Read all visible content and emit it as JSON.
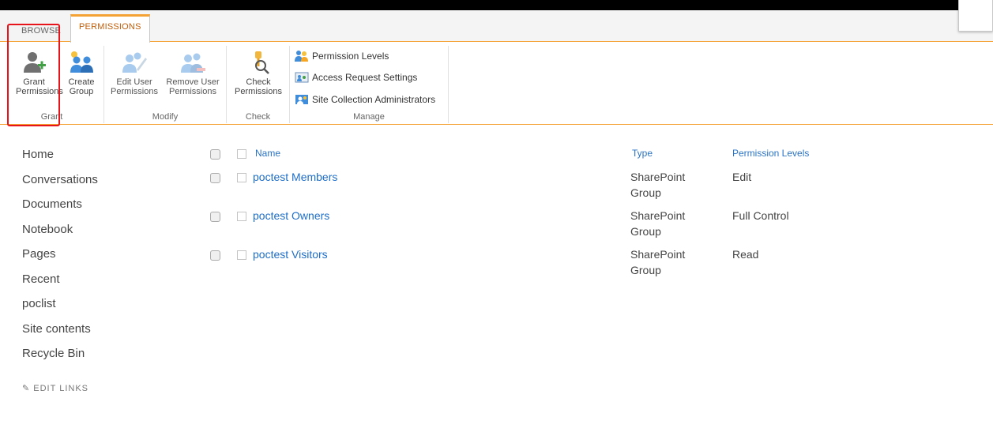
{
  "tabs": {
    "browse": "BROWSE",
    "permissions": "PERMISSIONS"
  },
  "ribbon": {
    "grant": {
      "label": "Grant",
      "grant_permissions": "Grant Permissions",
      "create_group": "Create Group"
    },
    "modify": {
      "label": "Modify",
      "edit_user_permissions": "Edit User Permissions",
      "remove_user_permissions": "Remove User Permissions"
    },
    "check": {
      "label": "Check",
      "check_permissions": "Check Permissions"
    },
    "manage": {
      "label": "Manage",
      "permission_levels": "Permission Levels",
      "access_request_settings": "Access Request Settings",
      "site_collection_administrators": "Site Collection Administrators"
    }
  },
  "nav": {
    "items": [
      "Home",
      "Conversations",
      "Documents",
      "Notebook",
      "Pages",
      "Recent",
      "poclist",
      "Site contents",
      "Recycle Bin"
    ],
    "edit_links": "EDIT LINKS"
  },
  "list": {
    "columns": {
      "name": "Name",
      "type": "Type",
      "permission_levels": "Permission Levels"
    },
    "rows": [
      {
        "name": "poctest Members",
        "type": "SharePoint Group",
        "permission": "Edit"
      },
      {
        "name": "poctest Owners",
        "type": "SharePoint Group",
        "permission": "Full Control"
      },
      {
        "name": "poctest Visitors",
        "type": "SharePoint Group",
        "permission": "Read"
      }
    ]
  },
  "colors": {
    "accent": "#f4a233",
    "link": "#1e6ec8",
    "highlight": "#e8141b"
  }
}
